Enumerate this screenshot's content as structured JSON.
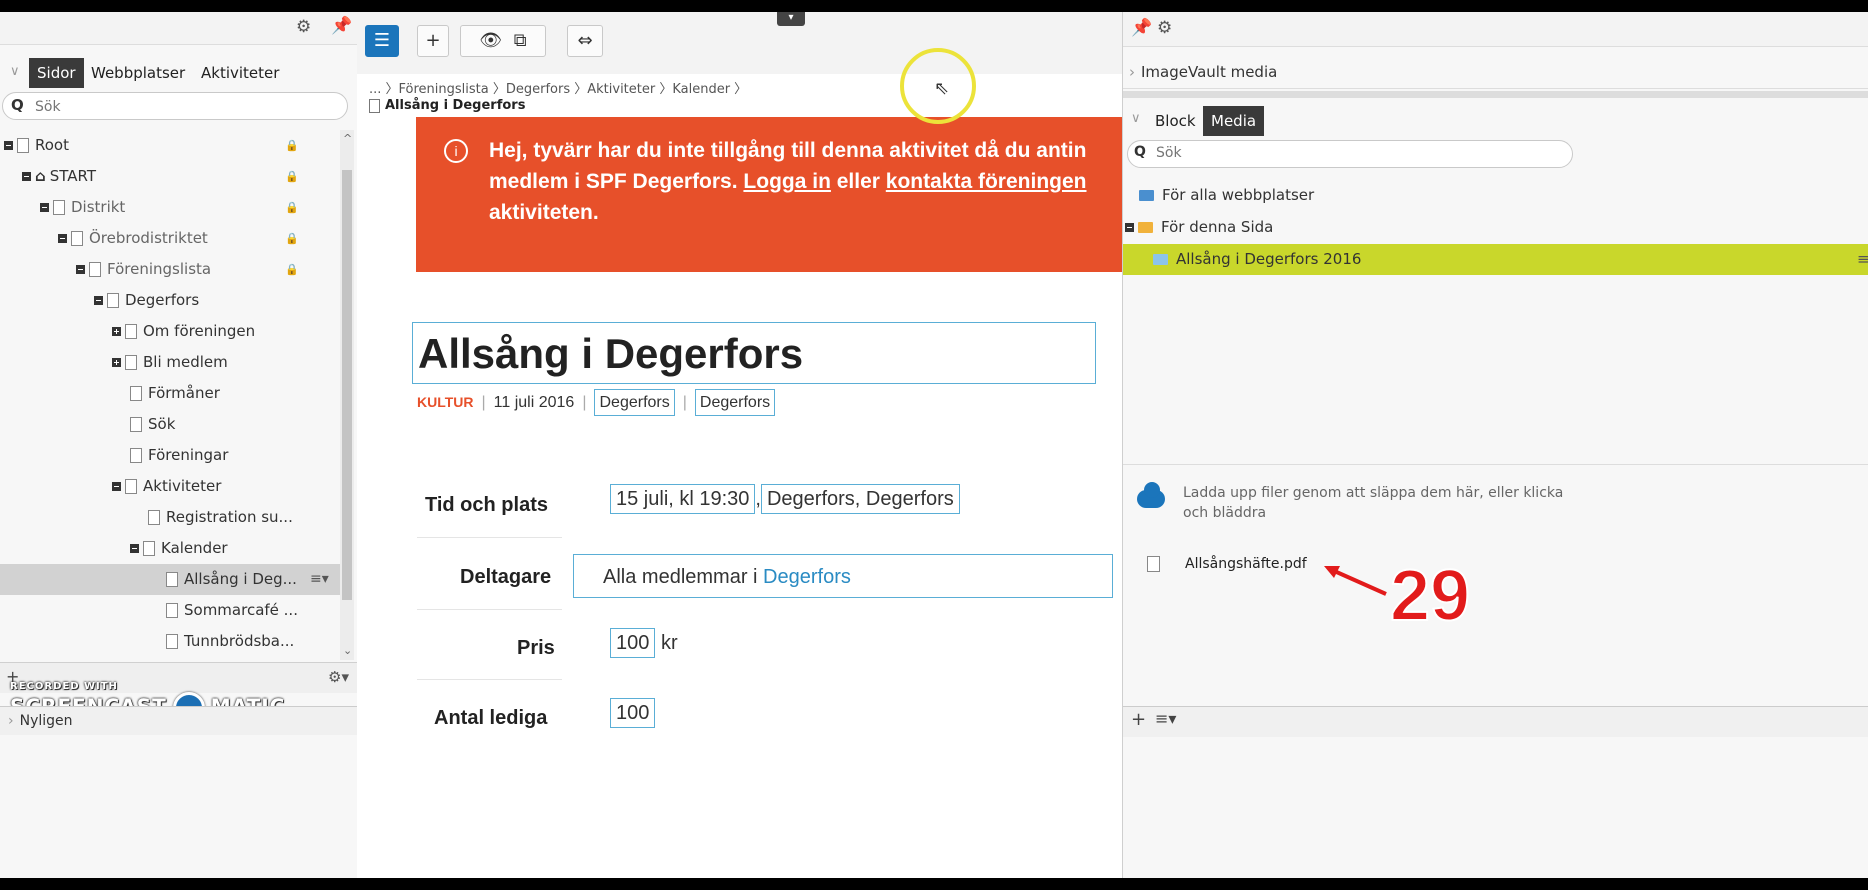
{
  "left": {
    "tabs": [
      "Sidor",
      "Webbplatser",
      "Aktiviteter"
    ],
    "search_placeholder": "Sök",
    "tree": [
      {
        "label": "Root",
        "indent": 0,
        "expander": "minus",
        "icon": "root",
        "lock": true
      },
      {
        "label": "START",
        "indent": 1,
        "expander": "minus",
        "icon": "home",
        "lock": true
      },
      {
        "label": "Distrikt",
        "indent": 2,
        "expander": "minus",
        "icon": "page",
        "lock": true,
        "dim": true
      },
      {
        "label": "Örebrodistriktet",
        "indent": 3,
        "expander": "minus",
        "icon": "page",
        "lock": true,
        "dim": true
      },
      {
        "label": "Föreningslista",
        "indent": 4,
        "expander": "minus",
        "icon": "page",
        "lock": true,
        "dim": true
      },
      {
        "label": "Degerfors",
        "indent": 5,
        "expander": "minus",
        "icon": "page"
      },
      {
        "label": "Om föreningen",
        "indent": 6,
        "expander": "plus",
        "icon": "page"
      },
      {
        "label": "Bli medlem",
        "indent": 6,
        "expander": "plus",
        "icon": "page"
      },
      {
        "label": "Förmåner",
        "indent": 7,
        "icon": "page"
      },
      {
        "label": "Sök",
        "indent": 7,
        "icon": "page"
      },
      {
        "label": "Föreningar",
        "indent": 7,
        "icon": "page"
      },
      {
        "label": "Aktiviteter",
        "indent": 6,
        "expander": "minus",
        "icon": "page"
      },
      {
        "label": "Registration su...",
        "indent": 8,
        "icon": "page"
      },
      {
        "label": "Kalender",
        "indent": 7,
        "expander": "minus",
        "icon": "page"
      },
      {
        "label": "Allsång i Deg...",
        "indent": 9,
        "icon": "page",
        "selected": true
      },
      {
        "label": "Sommarcafé ...",
        "indent": 9,
        "icon": "page"
      },
      {
        "label": "Tunnbrödsba...",
        "indent": 9,
        "icon": "page"
      }
    ],
    "recent_label": "Nyligen",
    "watermark_top": "RECORDED WITH",
    "watermark_left": "SCREENCAST",
    "watermark_right": "MATIC"
  },
  "center": {
    "breadcrumb": "... 〉Föreningslista 〉Degerfors 〉Aktiviteter 〉Kalender 〉",
    "current_page": "Allsång i Degerfors",
    "alert_line1": "Hej, tyvärr har du inte tillgång till denna aktivitet då du antin",
    "alert_line2_a": "medlem i SPF Degerfors. ",
    "alert_link1": "Logga in",
    "alert_line2_b": " eller ",
    "alert_link2": "kontakta föreningen",
    "alert_line3": "aktiviteten.",
    "title": "Allsång i Degerfors",
    "category": "KULTUR",
    "date": "11 juli 2016",
    "tag1": "Degerfors",
    "tag2": "Degerfors",
    "fields": {
      "tid_label": "Tid och plats",
      "tid_value1": "15 juli, kl 19:30",
      "tid_sep": ",",
      "tid_value2": "Degerfors, Degerfors",
      "deltagare_label": "Deltagare",
      "deltagare_prefix": "Alla medlemmar i ",
      "deltagare_link": "Degerfors",
      "pris_label": "Pris",
      "pris_value": "100",
      "pris_unit": "kr",
      "antal_label": "Antal lediga",
      "antal_value": "100"
    }
  },
  "right": {
    "imagevault": "ImageVault media",
    "tabs": [
      "Block",
      "Media"
    ],
    "search_placeholder": "Sök",
    "folders": [
      "För alla webbplatser",
      "För denna Sida",
      "Allsång i Degerfors 2016"
    ],
    "upload_text": "Ladda upp filer genom att släppa dem här, eller klicka och bläddra",
    "file": "Allsångshäfte.pdf"
  },
  "annotation": "29"
}
